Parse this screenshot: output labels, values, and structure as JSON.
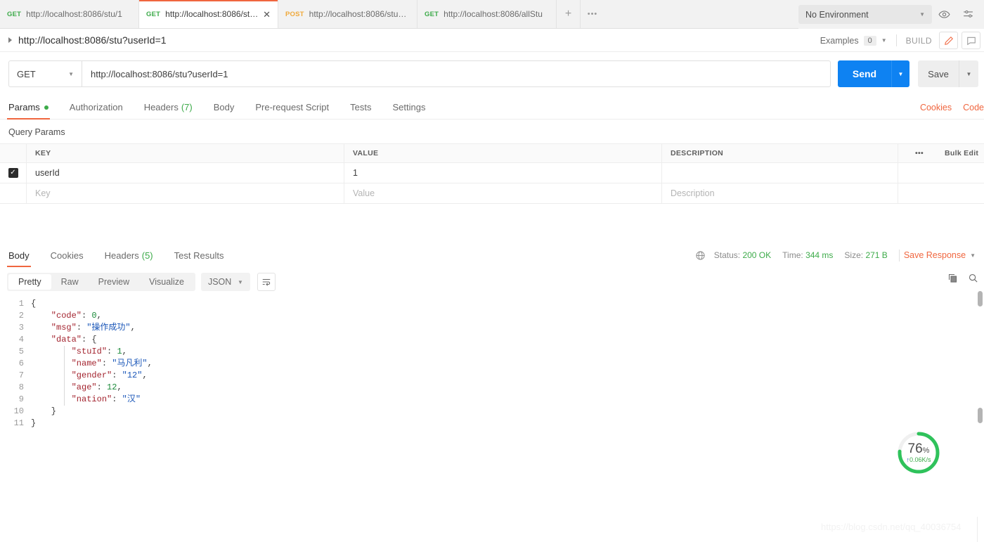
{
  "tabs": [
    {
      "method": "GET",
      "url": "http://localhost:8086/stu/1",
      "active": false,
      "closable": false
    },
    {
      "method": "GET",
      "url": "http://localhost:8086/stu?userI...",
      "active": true,
      "closable": true
    },
    {
      "method": "POST",
      "url": "http://localhost:8086/stuPage...",
      "active": false,
      "closable": false
    },
    {
      "method": "GET",
      "url": "http://localhost:8086/allStu",
      "active": false,
      "closable": false
    }
  ],
  "tabbar": {
    "new_tab_label": "+",
    "more_label": "•••"
  },
  "environment": {
    "selected": "No Environment"
  },
  "request_title": {
    "name": "http://localhost:8086/stu?userId=1",
    "examples_label": "Examples",
    "examples_count": "0",
    "build_label": "BUILD"
  },
  "url_bar": {
    "method": "GET",
    "url": "http://localhost:8086/stu?userId=1",
    "send_label": "Send",
    "save_label": "Save"
  },
  "request_tabs": [
    {
      "label": "Params",
      "active": true,
      "dot": true
    },
    {
      "label": "Authorization",
      "active": false,
      "dot": false
    },
    {
      "label": "Headers",
      "active": false,
      "count": "(7)"
    },
    {
      "label": "Body",
      "active": false
    },
    {
      "label": "Pre-request Script",
      "active": false
    },
    {
      "label": "Tests",
      "active": false
    },
    {
      "label": "Settings",
      "active": false
    }
  ],
  "request_links": {
    "cookies": "Cookies",
    "code": "Code"
  },
  "query_params": {
    "section_label": "Query Params",
    "columns": [
      "KEY",
      "VALUE",
      "DESCRIPTION"
    ],
    "more_label": "•••",
    "bulk_edit_label": "Bulk Edit",
    "rows": [
      {
        "checked": true,
        "key": "userId",
        "value": "1",
        "description": ""
      }
    ],
    "placeholders": {
      "key": "Key",
      "value": "Value",
      "description": "Description"
    }
  },
  "response": {
    "tabs": [
      {
        "label": "Body",
        "active": true
      },
      {
        "label": "Cookies",
        "active": false
      },
      {
        "label": "Headers",
        "count": "(5)",
        "active": false
      },
      {
        "label": "Test Results",
        "active": false
      }
    ],
    "status_label": "Status:",
    "status_value": "200 OK",
    "time_label": "Time:",
    "time_value": "344 ms",
    "size_label": "Size:",
    "size_value": "271 B",
    "save_response_label": "Save Response",
    "view_modes": [
      {
        "label": "Pretty",
        "active": true
      },
      {
        "label": "Raw",
        "active": false
      },
      {
        "label": "Preview",
        "active": false
      },
      {
        "label": "Visualize",
        "active": false
      }
    ],
    "format": "JSON",
    "body_lines": [
      {
        "n": "1",
        "segments": [
          {
            "t": "{",
            "c": "p"
          }
        ]
      },
      {
        "n": "2",
        "segments": [
          {
            "t": "    \"code\"",
            "c": "key"
          },
          {
            "t": ": ",
            "c": "p"
          },
          {
            "t": "0",
            "c": "num"
          },
          {
            "t": ",",
            "c": "p"
          }
        ]
      },
      {
        "n": "3",
        "segments": [
          {
            "t": "    \"msg\"",
            "c": "key"
          },
          {
            "t": ": ",
            "c": "p"
          },
          {
            "t": "\"操作成功\"",
            "c": "str"
          },
          {
            "t": ",",
            "c": "p"
          }
        ]
      },
      {
        "n": "4",
        "segments": [
          {
            "t": "    \"data\"",
            "c": "key"
          },
          {
            "t": ": {",
            "c": "p"
          }
        ]
      },
      {
        "n": "5",
        "segments": [
          {
            "t": "        \"stuId\"",
            "c": "key"
          },
          {
            "t": ": ",
            "c": "p"
          },
          {
            "t": "1",
            "c": "num"
          },
          {
            "t": ",",
            "c": "p"
          }
        ]
      },
      {
        "n": "6",
        "segments": [
          {
            "t": "        \"name\"",
            "c": "key"
          },
          {
            "t": ": ",
            "c": "p"
          },
          {
            "t": "\"马凡利\"",
            "c": "str"
          },
          {
            "t": ",",
            "c": "p"
          }
        ]
      },
      {
        "n": "7",
        "segments": [
          {
            "t": "        \"gender\"",
            "c": "key"
          },
          {
            "t": ": ",
            "c": "p"
          },
          {
            "t": "\"12\"",
            "c": "str"
          },
          {
            "t": ",",
            "c": "p"
          }
        ]
      },
      {
        "n": "8",
        "segments": [
          {
            "t": "        \"age\"",
            "c": "key"
          },
          {
            "t": ": ",
            "c": "p"
          },
          {
            "t": "12",
            "c": "num"
          },
          {
            "t": ",",
            "c": "p"
          }
        ]
      },
      {
        "n": "9",
        "segments": [
          {
            "t": "        \"nation\"",
            "c": "key"
          },
          {
            "t": ": ",
            "c": "p"
          },
          {
            "t": "\"汉\"",
            "c": "str"
          }
        ]
      },
      {
        "n": "10",
        "segments": [
          {
            "t": "    }",
            "c": "p"
          }
        ]
      },
      {
        "n": "11",
        "segments": [
          {
            "t": "}",
            "c": "p"
          }
        ]
      }
    ]
  },
  "speed_widget": {
    "percent": "76",
    "percent_symbol": "%",
    "rate": "0.06K/s",
    "arrow": "↑",
    "value": 76,
    "ring_color": "#2fc25b"
  },
  "watermark": {
    "text": "https://blog.csdn.net/qq_40036754"
  },
  "colors": {
    "accent_orange": "#f0663f",
    "send_blue": "#0e82f2",
    "green": "#3dab4a"
  }
}
